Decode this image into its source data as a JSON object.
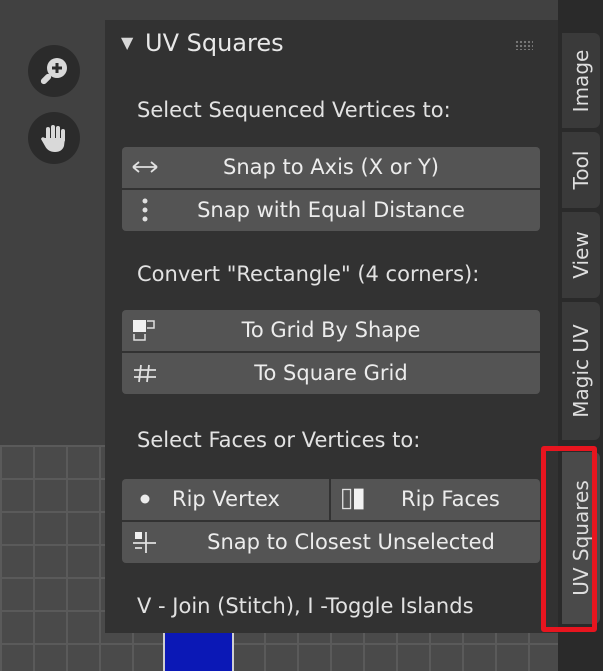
{
  "panel": {
    "title": "UV Squares",
    "section_sequenced": "Select Sequenced Vertices to:",
    "snap_axis_label": "Snap to Axis (X or Y)",
    "snap_equal_label": "Snap with Equal Distance",
    "section_convert": "Convert \"Rectangle\" (4 corners):",
    "grid_shape_label": "To Grid By Shape",
    "square_grid_label": "To Square Grid",
    "section_faces": "Select Faces or Vertices to:",
    "rip_vertex_label": "Rip Vertex",
    "rip_faces_label": "Rip Faces",
    "snap_closest_label": "Snap to Closest Unselected",
    "shortcut_hint": "V - Join (Stitch), I -Toggle Islands"
  },
  "tabs": [
    {
      "label": "Image"
    },
    {
      "label": "Tool"
    },
    {
      "label": "View"
    },
    {
      "label": "Magic UV"
    },
    {
      "label": "UV Squares",
      "active": true
    }
  ],
  "icons": {
    "zoom": "zoom-in-icon",
    "pan": "hand-pan-icon",
    "snap_axis": "double-arrow-icon",
    "snap_equal": "vertical-dots-icon",
    "grid_shape": "grid-shape-icon",
    "square_grid": "hash-grid-icon",
    "rip_vertex": "dot-icon",
    "rip_faces": "rip-faces-icon",
    "snap_closest": "snap-closest-icon"
  },
  "colors": {
    "highlight": "#e8151f",
    "uv_face": "#1f2a7a",
    "uv_face_selected": "#0b18b6"
  }
}
